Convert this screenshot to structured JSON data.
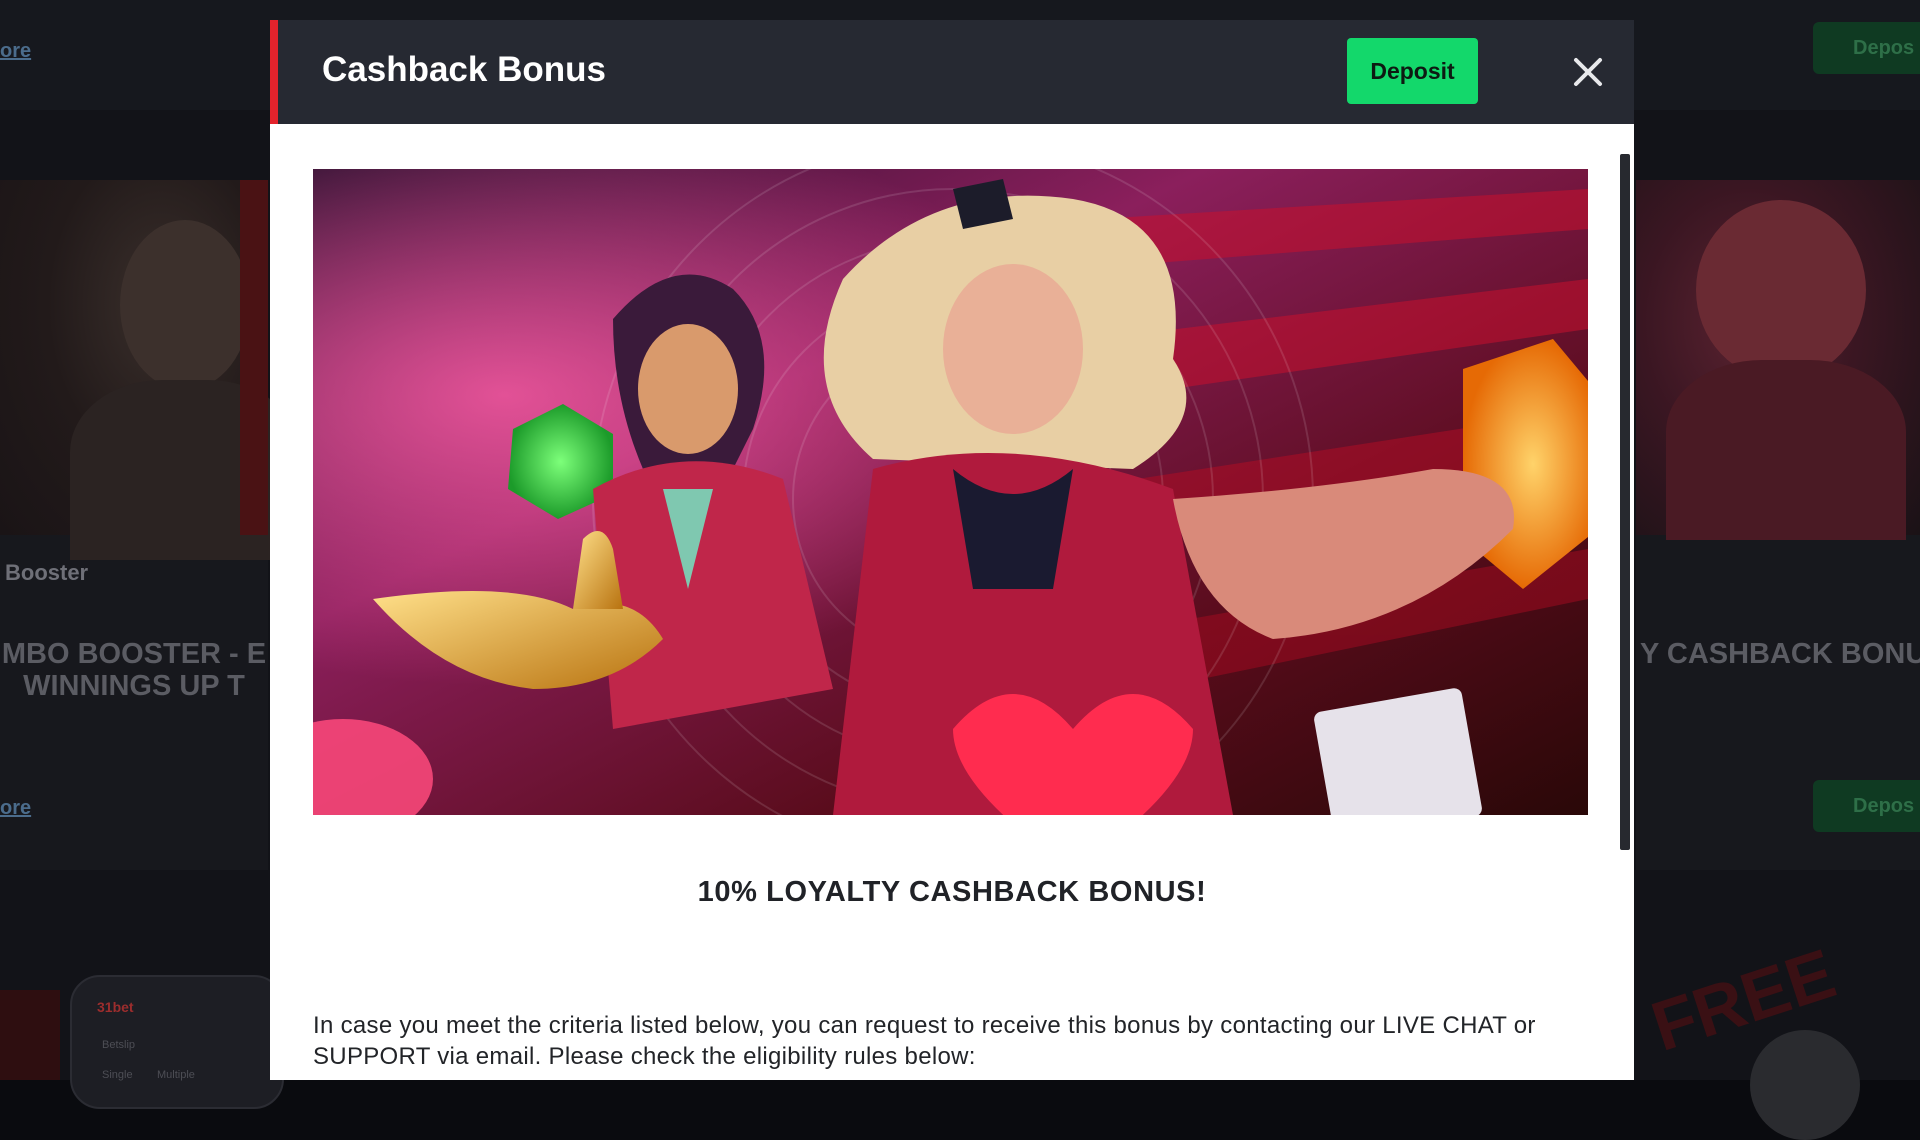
{
  "background": {
    "top_link": "ore",
    "mid_link": "ore",
    "left_card_label": "Booster",
    "left_card_headline_line1": "MBO BOOSTER - E",
    "left_card_headline_line2": "WINNINGS UP T",
    "right_card_headline": "Y CASHBACK BONU",
    "deposit_top": "Depos",
    "deposit_mid": "Depos",
    "phone_brand": "31bet",
    "phone_tab_1": "Betslip",
    "phone_tab_2": "Single",
    "phone_tab_3": "Multiple"
  },
  "modal": {
    "title": "Cashback Bonus",
    "deposit_label": "Deposit",
    "heading": "10% LOYALTY CASHBACK BONUS!",
    "body_text": "In case you meet the criteria listed below, you can request to receive this bonus by contacting our LIVE CHAT or SUPPORT via email. Please check the eligibility rules below:"
  },
  "icons": {
    "close": "close-icon"
  },
  "colors": {
    "header_bg": "#262932",
    "accent_red": "#e3232c",
    "deposit_green": "#13d86b"
  }
}
